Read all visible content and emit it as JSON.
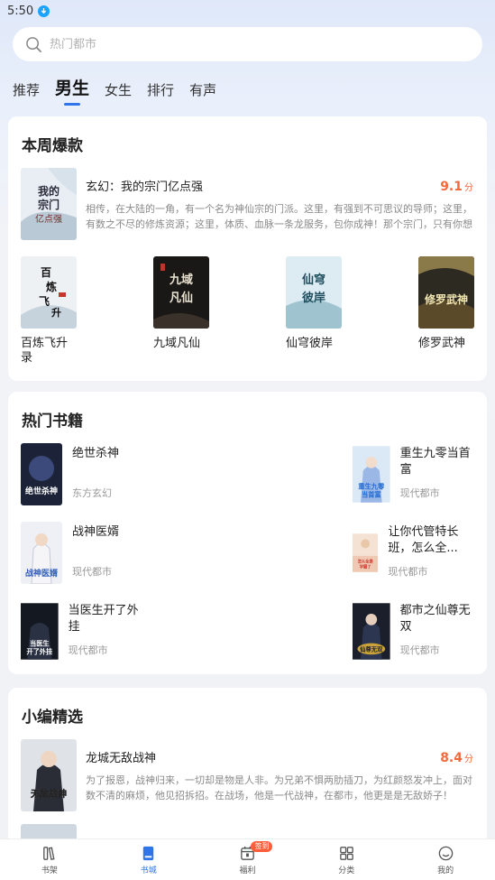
{
  "status": {
    "time": "5:50"
  },
  "search": {
    "placeholder": "热门都市"
  },
  "tabs": [
    "推荐",
    "男生",
    "女生",
    "排行",
    "有声"
  ],
  "weekly": {
    "title": "本周爆款",
    "featured": {
      "title": "玄幻：我的宗门亿点强",
      "score": "9.1",
      "score_unit": "分",
      "desc": "相传，在大陆的一角，有一个名为神仙宗的门派。这里，有强到不可思议的导师；这里，有数之不尽的修炼资源；这里，体质、血脉一条龙服务，包你成神！那个宗门，只有你想不到，没有它做不到！",
      "cover_text": "我的宗门亿点强"
    },
    "books": [
      {
        "name": "百炼飞升录",
        "cover_text": "百炼飞升"
      },
      {
        "name": "九域凡仙",
        "cover_text": "九域凡仙"
      },
      {
        "name": "仙穹彼岸",
        "cover_text": "仙穹彼岸"
      },
      {
        "name": "修罗武神",
        "cover_text": "修罗武神"
      }
    ]
  },
  "hot": {
    "title": "热门书籍",
    "left": [
      {
        "title": "绝世杀神",
        "category": "东方玄幻",
        "cover_text": "绝世杀神"
      },
      {
        "title": "战神医婿",
        "category": "现代都市",
        "cover_text": "战神医婿"
      },
      {
        "title": "当医生开了外挂",
        "category": "现代都市",
        "cover_text": "当医生开了外挂"
      }
    ],
    "right": [
      {
        "title": "重生九零当首富",
        "category": "现代都市",
        "cover_text": "重生九零当首富"
      },
      {
        "title": "让你代管特长班，怎么全...",
        "category": "现代都市",
        "cover_text": "怎么全是学霸了"
      },
      {
        "title": "都市之仙尊无双",
        "category": "现代都市",
        "cover_text": "仙尊无双"
      }
    ]
  },
  "editor": {
    "title": "小编精选",
    "featured": {
      "title": "龙城无敌战神",
      "score": "8.4",
      "score_unit": "分",
      "desc": "为了报恩，战神归来，一切却是物是人非。为兄弟不惧两肋插刀，为红颜怒发冲上，面对数不清的麻烦，他见招拆招。在战场，他是一代战神，在都市，他更是是无敌娇子！",
      "cover_text": "无敌战神"
    }
  },
  "nav": [
    {
      "label": "书架",
      "icon": "bookshelf-icon"
    },
    {
      "label": "书城",
      "icon": "book-icon"
    },
    {
      "label": "福利",
      "icon": "gift-calendar-icon",
      "badge": "签到"
    },
    {
      "label": "分类",
      "icon": "grid-icon"
    },
    {
      "label": "我的",
      "icon": "profile-icon"
    }
  ],
  "colors": {
    "accent": "#2f74e8",
    "score": "#f26a3c"
  }
}
